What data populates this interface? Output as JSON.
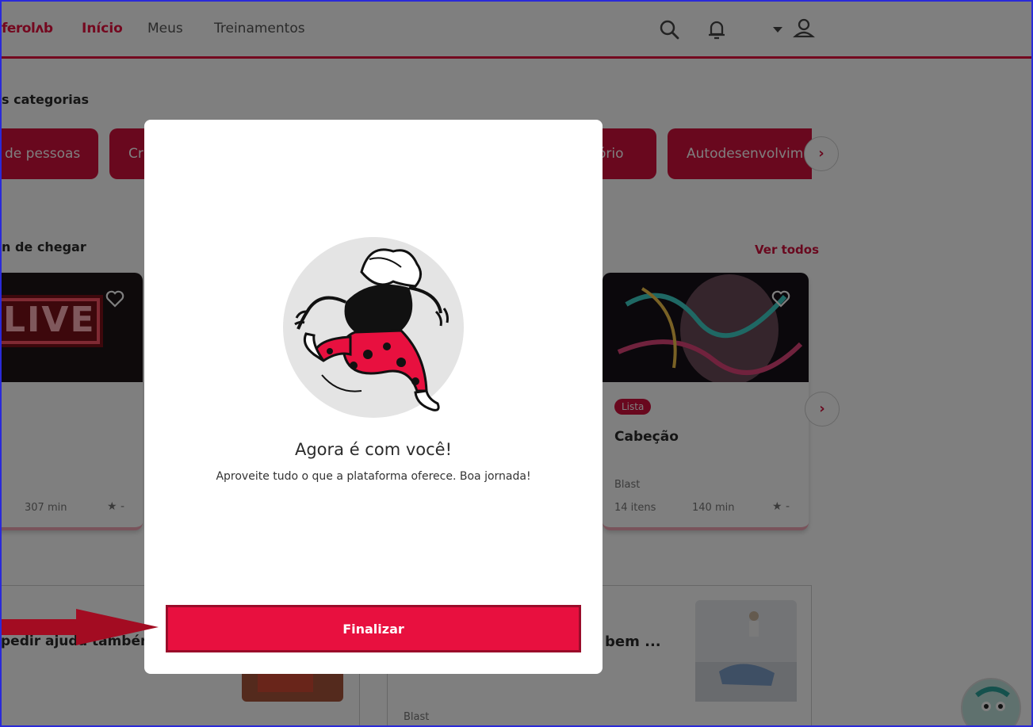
{
  "header": {
    "logo": "ferolʌb",
    "nav": [
      "Início",
      "Meus",
      "Treinamentos"
    ]
  },
  "categories": {
    "title": "s categorias",
    "items": [
      "de pessoas",
      "Cr",
      "ório",
      "Autodesenvolvim"
    ]
  },
  "recent": {
    "title": "n de chegar",
    "see_all": "Ver todos",
    "card_left": {
      "img_text": "LIVE",
      "duration": "307 min",
      "rating": "★ -"
    },
    "card_right": {
      "badge": "Lista",
      "title": "Cabeção",
      "author": "Blast",
      "items": "14 itens",
      "duration": "140 min",
      "rating": "★ -"
    }
  },
  "bottom": {
    "left_title": "pedir ajuda também",
    "right_title": "bem ...",
    "right_author": "Blast"
  },
  "modal": {
    "title": "Agora é com você!",
    "subtitle": "Aproveite tudo o que a plataforma oferece. Boa jornada!",
    "button": "Finalizar"
  },
  "colors": {
    "brand": "#e8103f",
    "pill": "#d2103c"
  },
  "icons": [
    "search-icon",
    "bell-icon",
    "caret-down-icon",
    "user-icon",
    "heart-icon",
    "chevron-right-icon"
  ]
}
